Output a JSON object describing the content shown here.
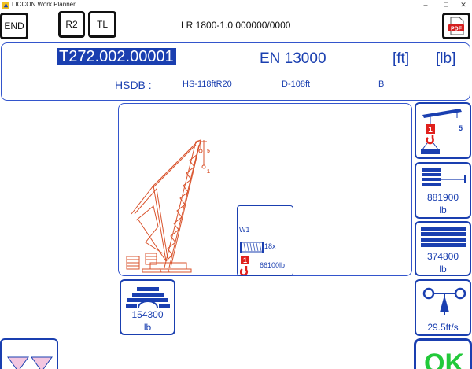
{
  "window": {
    "title": "LICCON Work Planner",
    "minimize": "–",
    "maximize": "□",
    "close": "✕"
  },
  "toolbar": {
    "end_label": "END",
    "r2_label": "R2",
    "tl_label": "TL",
    "pdf_label": "PDF",
    "model_text": "LR 1800-1.0  000000/0000"
  },
  "header": {
    "code": "T272.002.00001",
    "standard": "EN 13000",
    "unit_length": "[ft]",
    "unit_weight": "[lb]",
    "hsdb_label": "HSDB :",
    "hsdb_boom": "HS-118ftR20",
    "hsdb_derrick": "D-108ft",
    "hsdb_code": "B"
  },
  "crane": {
    "hook_tag_5": "5",
    "hook_tag_1": "1"
  },
  "winch_box": {
    "label": "W1",
    "reeving": "18x",
    "hook_number": "1",
    "load": "66100lb"
  },
  "side": {
    "rigging_number": "5",
    "rigging_hook": "1",
    "counterweight_superstructure": "881900",
    "counterweight_superstructure_unit": "lb",
    "counterweight_central": "374800",
    "counterweight_central_unit": "lb",
    "wind_speed": "29.5ft/s"
  },
  "derrick_ballast": {
    "value": "154300",
    "unit": "lb"
  },
  "ok_label": "OK",
  "colors": {
    "accent": "#1a3fb0",
    "crane": "#d9532c",
    "hook_red": "#e0201c",
    "ok_green": "#22c93a"
  }
}
